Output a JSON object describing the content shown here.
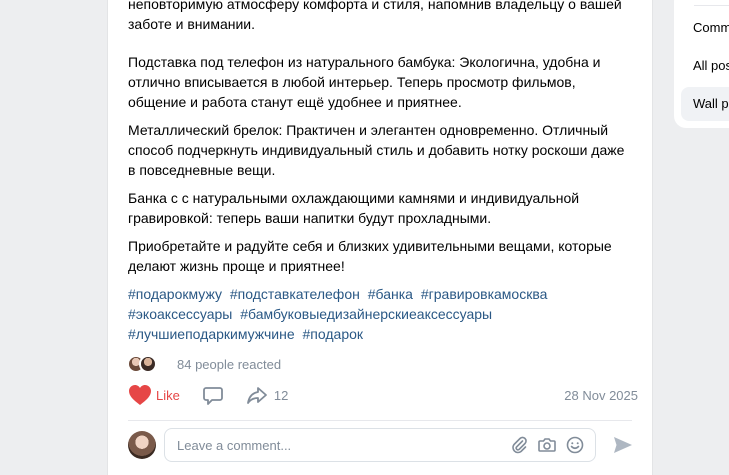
{
  "post": {
    "paragraphs": [
      "неповторимую атмосферу комфорта и стиля, напомнив владельцу о вашей заботе и внимании.",
      "Подставка под телефон из натурального бамбука: Экологична, удобна и отлично вписывается в любой интерьер. Теперь просмотр фильмов, общение и работа станут ещё удобнее и приятнее.",
      "Металлический брелок: Практичен и элегантен одновременно. Отличный способ подчеркнуть индивидуальный стиль и добавить нотку роскоши даже в повседневные вещи.",
      "Банка с с натуральными охлаждающими камнями и индивидуальной гравировкой: теперь ваши напитки будут прохладными.",
      "Приобретайте и радуйте себя и близких удивительными вещами, которые делают жизнь проще и приятнее!"
    ],
    "hashtags": [
      "#подарокмужу",
      "#подставкателефон",
      "#банка",
      "#гравировкамосква",
      "#экоаксессуары",
      "#бамбуковыедизайнерскиеаксессуары",
      "#лучшиеподаркимужчине",
      "#подарок"
    ],
    "reactions_text": "84 people reacted",
    "like_label": "Like",
    "share_count": "12",
    "date": "28 Nov 2025",
    "comment_placeholder": "Leave a comment...",
    "icons": [
      "heart-icon",
      "comment-icon",
      "share-icon",
      "paperclip-icon",
      "camera-icon",
      "emoji-icon",
      "send-icon"
    ]
  },
  "menu": {
    "items": [
      "Comm",
      "All pos",
      "Wall p"
    ]
  },
  "colors": {
    "like": "#e64646",
    "hashtag": "#2a5885",
    "muted": "#818c99",
    "background": "#edeef0"
  }
}
